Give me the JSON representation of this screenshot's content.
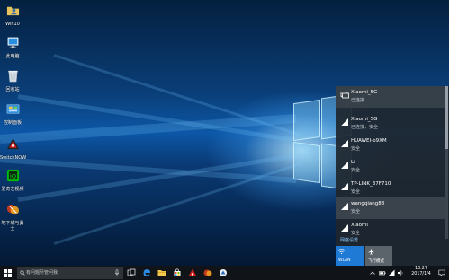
{
  "desktop": {
    "icons": [
      {
        "label": "Win10",
        "icon": "user-folder-icon"
      },
      {
        "label": "此电脑",
        "icon": "this-pc-icon"
      },
      {
        "label": "回收站",
        "icon": "recycle-bin-icon"
      },
      {
        "label": "控制面板",
        "icon": "control-panel-icon"
      },
      {
        "label": "SwitchNOW",
        "icon": "switchnow-icon"
      },
      {
        "label": "爱奇艺视频",
        "icon": "iqiyi-icon"
      },
      {
        "label": "地下城与勇士",
        "icon": "game-icon"
      }
    ]
  },
  "network": {
    "connected": {
      "name": "Xiaomi_5G",
      "status": "已连接"
    },
    "networks": [
      {
        "name": "Xiaomi_5G",
        "status": "已连接，安全"
      },
      {
        "name": "HUAWEI-b9XM",
        "status": "安全"
      },
      {
        "name": "Li",
        "status": "安全"
      },
      {
        "name": "TP-LINK_37F710",
        "status": "安全"
      },
      {
        "name": "wangqiang88",
        "status": "安全"
      },
      {
        "name": "Xiaomi",
        "status": "安全"
      }
    ],
    "settings_link": "网络设置",
    "tiles": [
      {
        "label": "WLAN",
        "icon": "wifi-icon",
        "active": true
      },
      {
        "label": "飞行模式",
        "icon": "airplane-icon",
        "active": false
      }
    ]
  },
  "taskbar": {
    "search_placeholder": "有问题尽管问我",
    "clock": {
      "time": "13:27",
      "date": "2017/1/4"
    }
  },
  "colors": {
    "accent": "#1f7ad6",
    "flyout_bg": "#1f272e",
    "taskbar_bg": "#101418",
    "link": "#8cc8ff"
  }
}
